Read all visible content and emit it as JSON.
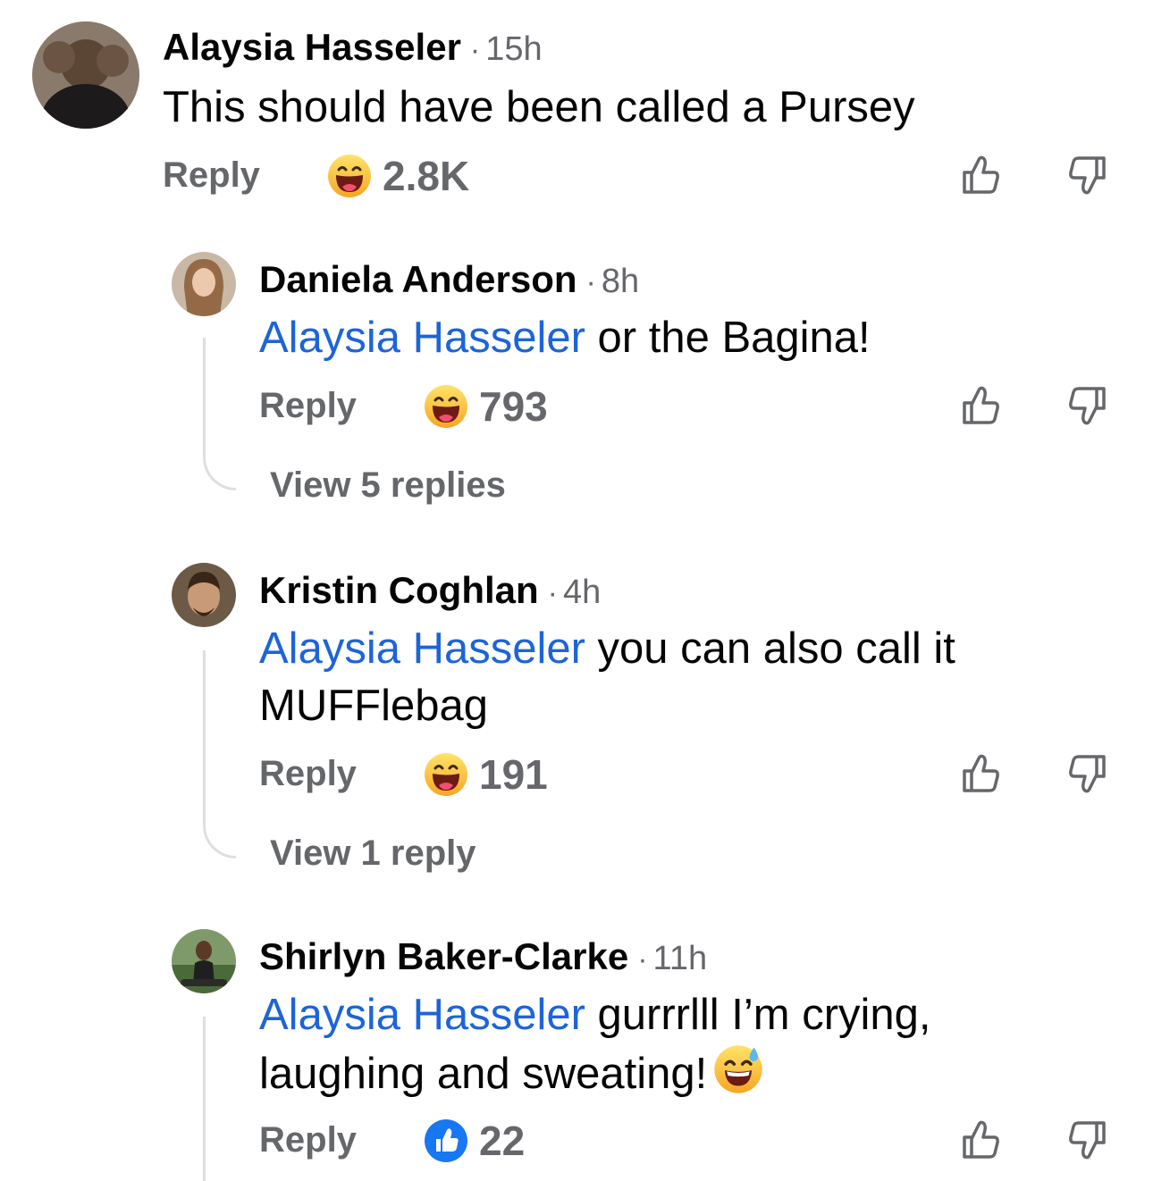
{
  "comments": [
    {
      "author": "Alaysia Hasseler",
      "time": "15h",
      "text": "This should have been called a Pursey",
      "reply_label": "Reply",
      "reaction_icon": "laughing-emoji-icon",
      "reaction_count": "2.8K"
    }
  ],
  "replies": [
    {
      "author": "Daniela Anderson",
      "time": "8h",
      "mention": "Alaysia Hasseler",
      "text": " or the Bagina!",
      "reply_label": "Reply",
      "reaction_icon": "laughing-emoji-icon",
      "reaction_count": "793",
      "view_replies": "View 5 replies"
    },
    {
      "author": "Kristin Coghlan",
      "time": "4h",
      "mention": "Alaysia Hasseler",
      "text": " you can also call it MUFFlebag",
      "reply_label": "Reply",
      "reaction_icon": "laughing-emoji-icon",
      "reaction_count": "191",
      "view_replies": "View 1 reply"
    },
    {
      "author": "Shirlyn Baker-Clarke",
      "time": "11h",
      "mention": "Alaysia Hasseler",
      "text": " gurrrlll I’m crying, laughing and sweating!",
      "trailing_emoji": "sweat-smile-emoji-icon",
      "reply_label": "Reply",
      "reaction_icon": "like-reaction-icon",
      "reaction_count": "22"
    }
  ],
  "colors": {
    "mention": "#1d64d8",
    "secondary_text": "#65676b",
    "like_blue": "#1877f2",
    "thread_line": "#dddfe2"
  }
}
